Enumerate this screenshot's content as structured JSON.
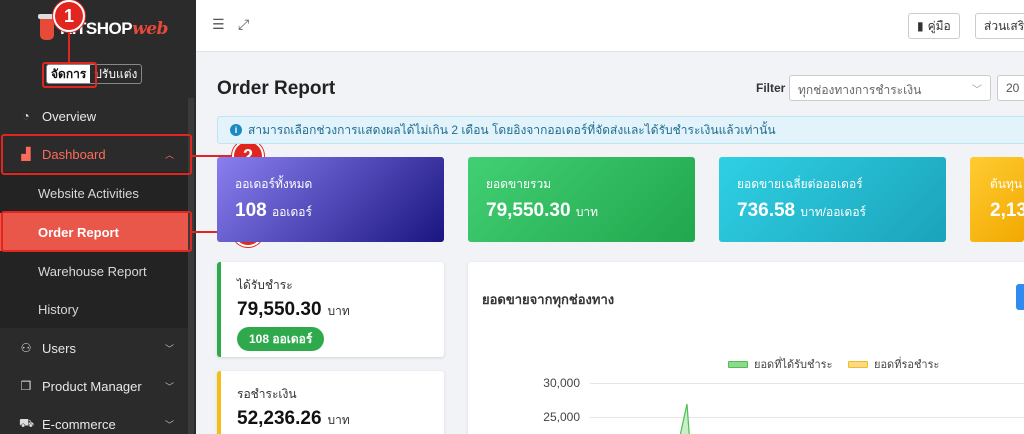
{
  "logo": {
    "text_main": "KITSHOP",
    "text_accent": "web"
  },
  "mode_switch": {
    "manage": "จัดการ",
    "customize": "ปรับแต่ง"
  },
  "sidebar": {
    "items": [
      {
        "label": "Overview",
        "icon": "pie-chart-icon"
      },
      {
        "label": "Dashboard",
        "icon": "bar-chart-icon"
      },
      {
        "label": "Users",
        "icon": "user-icon"
      },
      {
        "label": "Product Manager",
        "icon": "box-icon"
      },
      {
        "label": "E-commerce",
        "icon": "cart-icon"
      }
    ],
    "submenu": [
      "Website Activities",
      "Order Report",
      "Warehouse Report",
      "History"
    ]
  },
  "annotations": [
    "1",
    "2",
    "3"
  ],
  "topbar": {
    "manual_label": "คู่มือ",
    "extra_label": "ส่วนเสริ"
  },
  "page": {
    "title": "Order Report",
    "filter_label": "Filter",
    "filter_value": "ทุกช่องทางการชำระเงิน",
    "date_value": "20"
  },
  "info": "สามารถเลือกช่วงการแสดงผลได้ไม่เกิน 2 เดือน โดยอิงจากออเดอร์ที่จัดส่งและได้รับชำระเงินแล้วเท่านั้น",
  "kpis": [
    {
      "label": "ออเดอร์ทั้งหมด",
      "value": "108",
      "unit": "ออเดอร์"
    },
    {
      "label": "ยอดขายรวม",
      "value": "79,550.30",
      "unit": "บาท"
    },
    {
      "label": "ยอดขายเฉลี่ยต่อออเดอร์",
      "value": "736.58",
      "unit": "บาท/ออเดอร์"
    },
    {
      "label": "ต้นทุน",
      "value": "2,13",
      "unit": ""
    }
  ],
  "paid": {
    "label": "ได้รับชำระ",
    "value": "79,550.30",
    "unit": "บาท",
    "pill": "108 ออเดอร์"
  },
  "pending": {
    "label": "รอชำระเงิน",
    "value": "52,236.26",
    "unit": "บาท"
  },
  "chart": {
    "title": "ยอดขายจากทุกช่องทาง",
    "legend_paid": "ยอดที่ได้รับชำระ",
    "legend_pending": "ยอดที่รอชำระ",
    "ticks": [
      "30,000",
      "25,000"
    ],
    "colors": {
      "paid": "#8fd98f",
      "pending": "#ffd98a"
    }
  }
}
